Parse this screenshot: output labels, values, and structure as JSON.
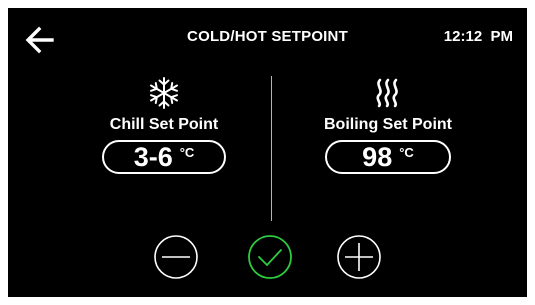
{
  "header": {
    "back_icon": "arrow-left-icon",
    "title": "COLD/HOT SETPOINT",
    "time": "12:12  PM"
  },
  "chill": {
    "icon": "snowflake-icon",
    "label": "Chill Set Point",
    "value": "3-6",
    "unit": "°C"
  },
  "boiling": {
    "icon": "heat-waves-icon",
    "label": "Boiling Set Point",
    "value": "98",
    "unit": "°C"
  },
  "controls": {
    "decrease_icon": "minus-circle-icon",
    "confirm_icon": "check-circle-icon",
    "increase_icon": "plus-circle-icon"
  },
  "colors": {
    "background": "#000000",
    "foreground": "#ffffff",
    "confirm": "#2ecc40",
    "divider": "#b5b5b5",
    "outer_border": "#ffffff"
  }
}
